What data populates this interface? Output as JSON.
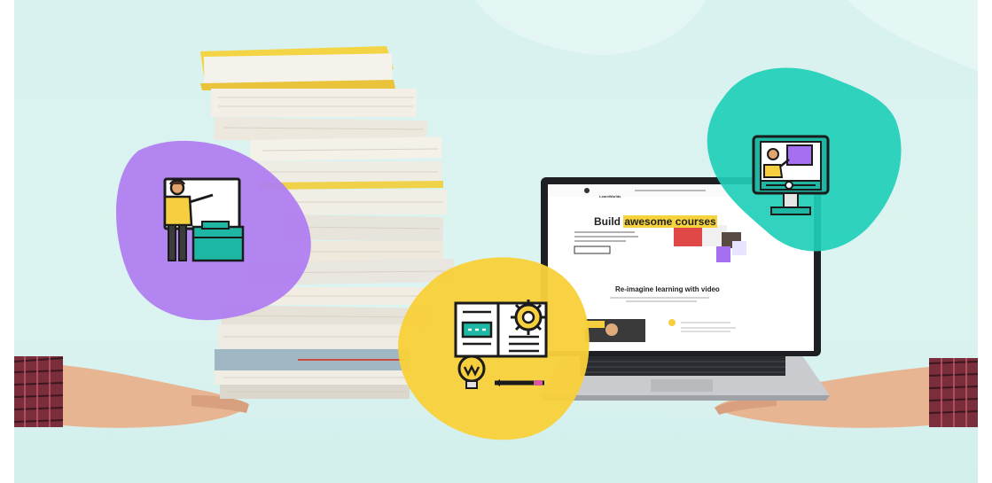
{
  "laptop": {
    "brand": "LearnWorlds",
    "headline_plain": "Build ",
    "headline_highlight": "awesome courses",
    "section_title": "Re-imagine learning with video"
  },
  "colors": {
    "background": "#d8f2ef",
    "purple_blob": "#b07ef0",
    "yellow_blob": "#f8d03a",
    "teal_blob": "#1fcfb8",
    "icon_teal": "#1db7a4",
    "icon_yellow": "#f6cf3f"
  },
  "icons": {
    "left": "teacher-blackboard-icon",
    "center": "book-idea-gear-icon",
    "right": "online-teacher-monitor-icon"
  }
}
